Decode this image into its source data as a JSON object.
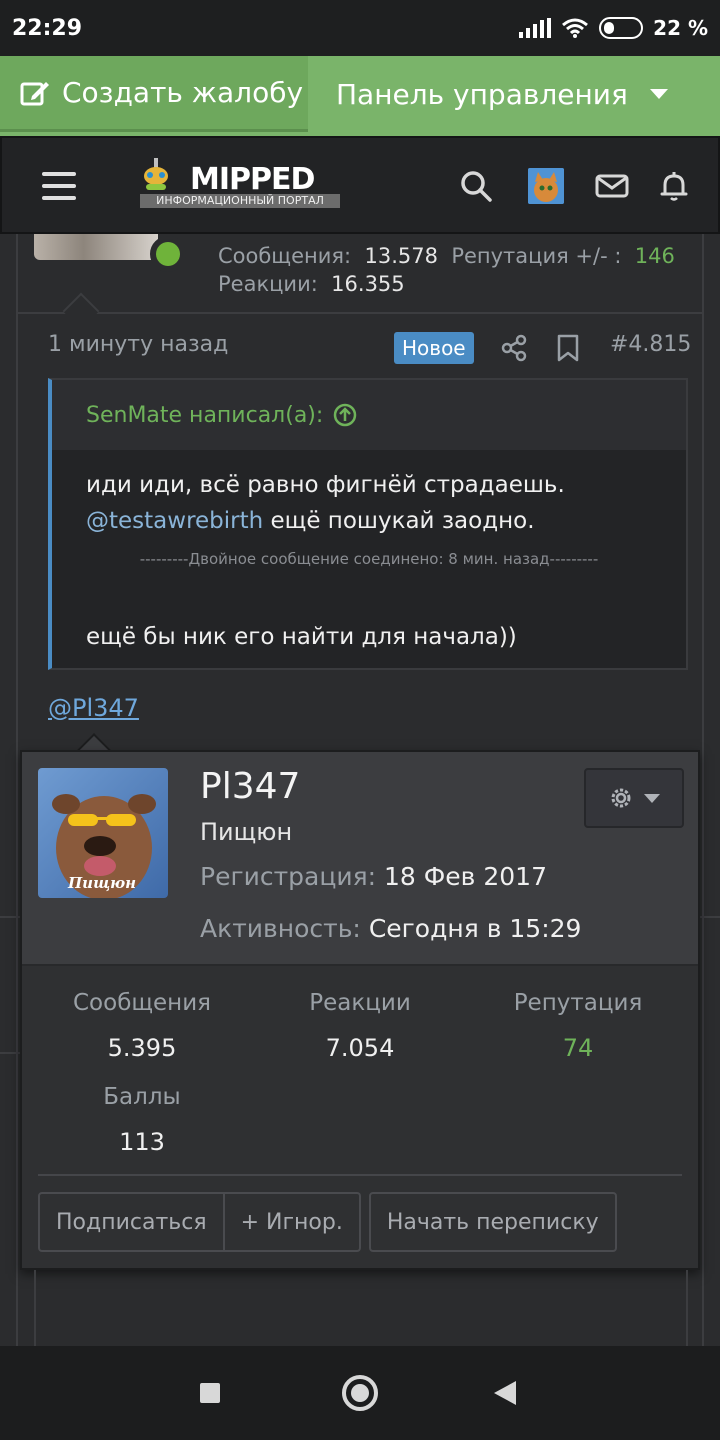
{
  "status": {
    "time": "22:29",
    "battery": "22 %"
  },
  "topbar": {
    "complaint_label": "Создать жалобу",
    "panel_label": "Панель управления"
  },
  "header": {
    "logo_title": "MIPPED",
    "logo_subtitle": "ИНФОРМАЦИОННЫЙ ПОРТАЛ"
  },
  "author_stats": {
    "messages_label": "Сообщения:",
    "messages_value": "13.578",
    "reputation_label": "Репутация +/- :",
    "reputation_value": "146",
    "reactions_label": "Реакции:",
    "reactions_value": "16.355"
  },
  "post": {
    "time": "1 минуту назад",
    "badge": "Новое",
    "number": "#4.815"
  },
  "quote": {
    "author": "SenMate написал(а):",
    "line1": "иди иди, всё равно фигнёй страдаешь.",
    "mention": "@testawrebirth",
    "line2_rest": " ещё пошукай заодно.",
    "merged_note": "---------Двойное сообщение соединено: 8 мин. назад---------",
    "line3": "ещё бы ник его найти для начала))"
  },
  "mention_link": "@Pl347",
  "profile_popup": {
    "avatar_caption": "Пищюн",
    "username": "Pl347",
    "user_title": "Пищюн",
    "registered_label": "Регистрация:",
    "registered_value": "18 Фев 2017",
    "activity_label": "Активность:",
    "activity_value": "Сегодня в 15:29",
    "stats": [
      {
        "label": "Сообщения",
        "value": "5.395"
      },
      {
        "label": "Реакции",
        "value": "7.054"
      },
      {
        "label": "Репутация",
        "value": "74"
      },
      {
        "label": "Баллы",
        "value": "113"
      }
    ],
    "buttons": {
      "follow": "Подписаться",
      "ignore": "+ Игнор.",
      "message": "Начать переписку"
    }
  },
  "colors": {
    "accent_green": "#7ab46a",
    "link_blue": "#6fa8dc",
    "badge_blue": "#4a8cc4",
    "positive_green": "#6fb35a"
  }
}
